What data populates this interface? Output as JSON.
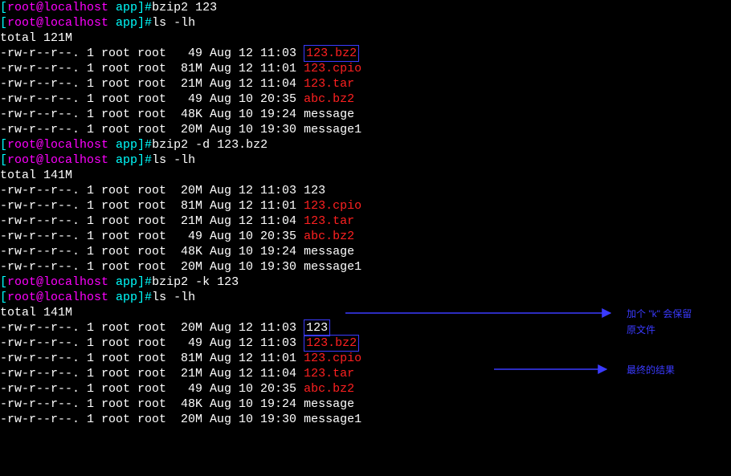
{
  "prompt_user": "root",
  "prompt_host": "localhost",
  "prompt_dir": "app",
  "cmds": {
    "c1": "bzip2 123",
    "c2": "ls -lh",
    "c3": "bzip2 -d 123.bz2",
    "c4": "ls -lh",
    "c5": "bzip2 -k 123",
    "c6": "ls -lh"
  },
  "totals": {
    "t1": "total 121M",
    "t2": "total 141M",
    "t3": "total 141M"
  },
  "ls1": [
    {
      "perm": "-rw-r--r--.",
      "n": "1",
      "u": "root",
      "g": "root",
      "size": "  49",
      "date": "Aug 12 11:03",
      "name": "123.bz2",
      "color": "red",
      "boxed": true
    },
    {
      "perm": "-rw-r--r--.",
      "n": "1",
      "u": "root",
      "g": "root",
      "size": " 81M",
      "date": "Aug 12 11:01",
      "name": "123.cpio",
      "color": "red"
    },
    {
      "perm": "-rw-r--r--.",
      "n": "1",
      "u": "root",
      "g": "root",
      "size": " 21M",
      "date": "Aug 12 11:04",
      "name": "123.tar",
      "color": "red"
    },
    {
      "perm": "-rw-r--r--.",
      "n": "1",
      "u": "root",
      "g": "root",
      "size": "  49",
      "date": "Aug 10 20:35",
      "name": "abc.bz2",
      "color": "red"
    },
    {
      "perm": "-rw-r--r--.",
      "n": "1",
      "u": "root",
      "g": "root",
      "size": " 48K",
      "date": "Aug 10 19:24",
      "name": "message",
      "color": "white"
    },
    {
      "perm": "-rw-r--r--.",
      "n": "1",
      "u": "root",
      "g": "root",
      "size": " 20M",
      "date": "Aug 10 19:30",
      "name": "message1",
      "color": "white"
    }
  ],
  "ls2": [
    {
      "perm": "-rw-r--r--.",
      "n": "1",
      "u": "root",
      "g": "root",
      "size": " 20M",
      "date": "Aug 12 11:03",
      "name": "123",
      "color": "white"
    },
    {
      "perm": "-rw-r--r--.",
      "n": "1",
      "u": "root",
      "g": "root",
      "size": " 81M",
      "date": "Aug 12 11:01",
      "name": "123.cpio",
      "color": "red"
    },
    {
      "perm": "-rw-r--r--.",
      "n": "1",
      "u": "root",
      "g": "root",
      "size": " 21M",
      "date": "Aug 12 11:04",
      "name": "123.tar",
      "color": "red"
    },
    {
      "perm": "-rw-r--r--.",
      "n": "1",
      "u": "root",
      "g": "root",
      "size": "  49",
      "date": "Aug 10 20:35",
      "name": "abc.bz2",
      "color": "red"
    },
    {
      "perm": "-rw-r--r--.",
      "n": "1",
      "u": "root",
      "g": "root",
      "size": " 48K",
      "date": "Aug 10 19:24",
      "name": "message",
      "color": "white"
    },
    {
      "perm": "-rw-r--r--.",
      "n": "1",
      "u": "root",
      "g": "root",
      "size": " 20M",
      "date": "Aug 10 19:30",
      "name": "message1",
      "color": "white"
    }
  ],
  "ls3": [
    {
      "perm": "-rw-r--r--.",
      "n": "1",
      "u": "root",
      "g": "root",
      "size": " 20M",
      "date": "Aug 12 11:03",
      "name": "123",
      "color": "white",
      "boxed": true
    },
    {
      "perm": "-rw-r--r--.",
      "n": "1",
      "u": "root",
      "g": "root",
      "size": "  49",
      "date": "Aug 12 11:03",
      "name": "123.bz2",
      "color": "red",
      "boxed": true
    },
    {
      "perm": "-rw-r--r--.",
      "n": "1",
      "u": "root",
      "g": "root",
      "size": " 81M",
      "date": "Aug 12 11:01",
      "name": "123.cpio",
      "color": "red"
    },
    {
      "perm": "-rw-r--r--.",
      "n": "1",
      "u": "root",
      "g": "root",
      "size": " 21M",
      "date": "Aug 12 11:04",
      "name": "123.tar",
      "color": "red"
    },
    {
      "perm": "-rw-r--r--.",
      "n": "1",
      "u": "root",
      "g": "root",
      "size": "  49",
      "date": "Aug 10 20:35",
      "name": "abc.bz2",
      "color": "red"
    },
    {
      "perm": "-rw-r--r--.",
      "n": "1",
      "u": "root",
      "g": "root",
      "size": " 48K",
      "date": "Aug 10 19:24",
      "name": "message",
      "color": "white"
    },
    {
      "perm": "-rw-r--r--.",
      "n": "1",
      "u": "root",
      "g": "root",
      "size": " 20M",
      "date": "Aug 10 19:30",
      "name": "message1",
      "color": "white"
    }
  ],
  "annotations": {
    "a1_l1": "加个 \"k\" 会保留",
    "a1_l2": "原文件",
    "a2": "最终的结果"
  }
}
